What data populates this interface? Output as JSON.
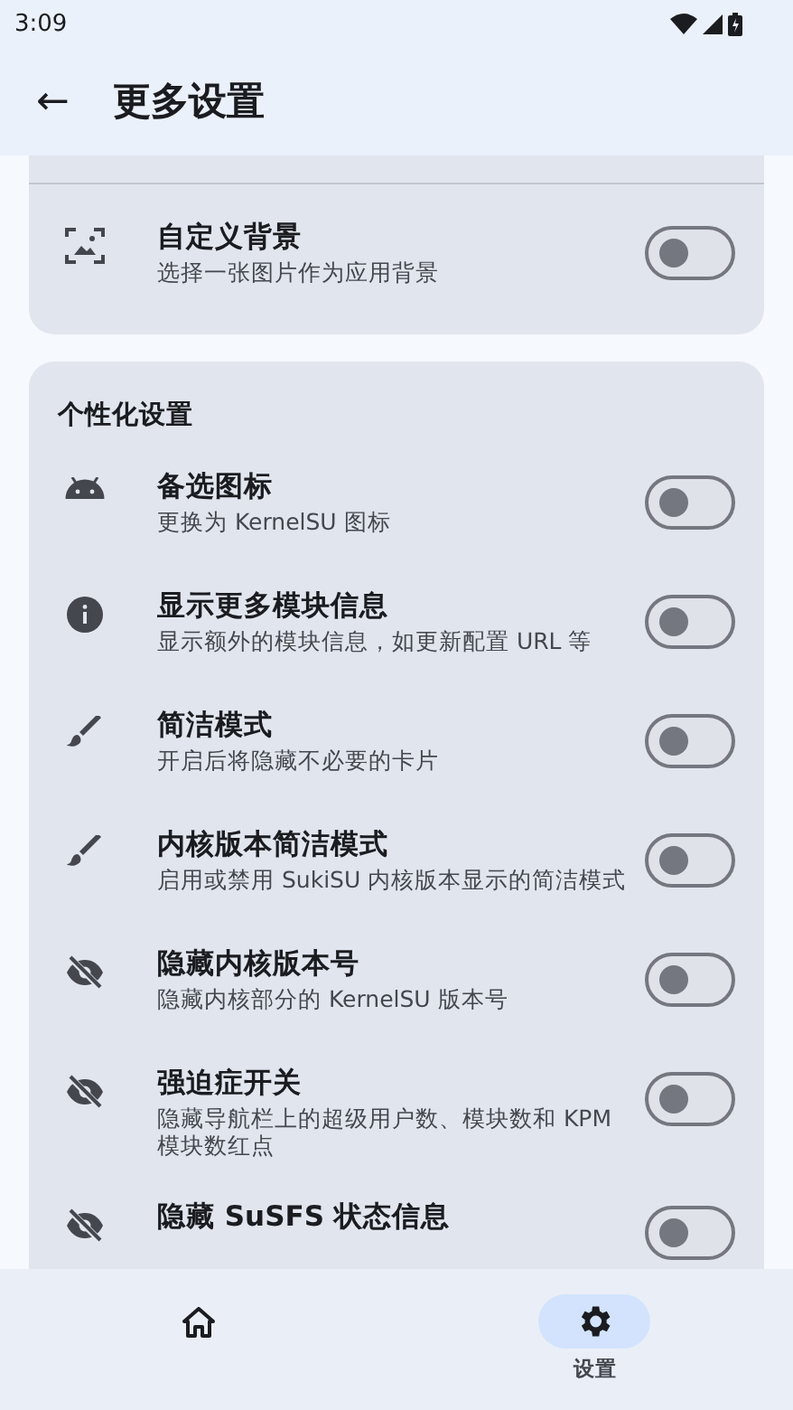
{
  "status_bar": {
    "time": "3:09"
  },
  "top_bar": {
    "title": "更多设置",
    "back_label": "←"
  },
  "sections": [
    {
      "rows": [
        {
          "title": "自定义背景",
          "subtitle": "选择一张图片作为应用背景",
          "on": false
        }
      ]
    },
    {
      "title": "个性化设置",
      "rows": [
        {
          "title": "备选图标",
          "subtitle": "更换为 KernelSU 图标",
          "on": false
        },
        {
          "title": "显示更多模块信息",
          "subtitle": "显示额外的模块信息，如更新配置 URL 等",
          "on": false
        },
        {
          "title": "简洁模式",
          "subtitle": "开启后将隐藏不必要的卡片",
          "on": false
        },
        {
          "title": "内核版本简洁模式",
          "subtitle": "启用或禁用 SukiSU 内核版本显示的简洁模式",
          "on": false
        },
        {
          "title": "隐藏内核版本号",
          "subtitle": "隐藏内核部分的 KernelSU 版本号",
          "on": false
        },
        {
          "title": "强迫症开关",
          "subtitle": "隐藏导航栏上的超级用户数、模块数和 KPM 模块数红点",
          "on": false
        },
        {
          "title": "隐藏 SuSFS 状态信息",
          "on": false
        }
      ]
    }
  ],
  "bottom_nav": [
    {
      "selected": false
    },
    {
      "label": "设置",
      "selected": true
    }
  ]
}
